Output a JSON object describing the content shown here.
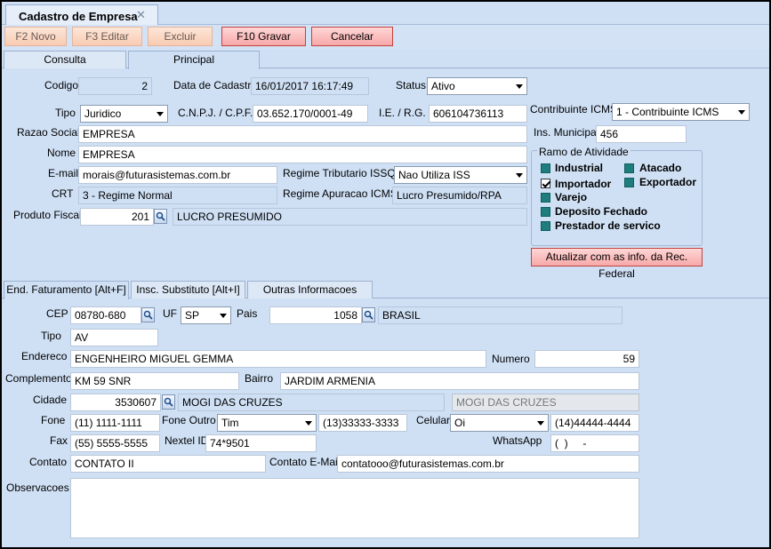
{
  "window": {
    "doc_tab_title": "Cadastro de Empresa",
    "close_glyph": "✕"
  },
  "toolbar": {
    "new": "F2 Novo",
    "edit": "F3 Editar",
    "delete": "Excluir",
    "save": "F10 Gravar",
    "cancel": "Cancelar"
  },
  "main_tabs": [
    {
      "label": "Consulta"
    },
    {
      "label": "Principal"
    }
  ],
  "form": {
    "codigo_label": "Codigo",
    "codigo": "2",
    "data_cadastro_label": "Data de Cadastro",
    "data_cadastro": "16/01/2017 16:17:49",
    "status_label": "Status",
    "status": "Ativo",
    "tipo_label": "Tipo",
    "tipo": "Juridico",
    "cnpj_label": "C.N.P.J. / C.P.F.",
    "cnpj": "03.652.170/0001-49",
    "ie_label": "I.E. / R.G.",
    "ie": "606104736113",
    "contribuinte_label": "Contribuinte ICMS",
    "contribuinte": "1 - Contribuinte ICMS",
    "razao_label": "Razao Social",
    "razao": "EMPRESA",
    "ins_municipal_label": "Ins. Municipal",
    "ins_municipal": "456",
    "nome_label": "Nome",
    "nome": "EMPRESA",
    "email_label": "E-mail",
    "email": "morais@futurasistemas.com.br",
    "regime_issqn_label": "Regime Tributario ISSQN",
    "regime_issqn": "Nao Utiliza ISS",
    "crt_label": "CRT",
    "crt": "3 - Regime Normal",
    "regime_icms_label": "Regime Apuracao ICMS:",
    "regime_icms": "Lucro Presumido/RPA",
    "produto_fiscal_label": "Produto Fiscal",
    "produto_fiscal_code": "201",
    "produto_fiscal_desc": "LUCRO PRESUMIDO"
  },
  "ramo": {
    "title": "Ramo de Atividade",
    "items": [
      {
        "label": "Industrial",
        "checked": false
      },
      {
        "label": "Atacado",
        "checked": false
      },
      {
        "label": "Importador",
        "checked": true
      },
      {
        "label": "Exportador",
        "checked": false
      },
      {
        "label": "Varejo",
        "checked": false
      },
      {
        "label": "Deposito Fechado",
        "checked": false
      },
      {
        "label": "Prestador de servico",
        "checked": false
      }
    ],
    "update_button": "Atualizar com as info. da Rec. Federal"
  },
  "sub_tabs": [
    {
      "label": "End. Faturamento [Alt+F]"
    },
    {
      "label": "Insc. Substituto [Alt+I]"
    },
    {
      "label": "Outras Informacoes [Alt+O]"
    }
  ],
  "address": {
    "cep_label": "CEP",
    "cep": "08780-680",
    "uf_label": "UF",
    "uf": "SP",
    "pais_label": "Pais",
    "pais_code": "1058",
    "pais_name": "BRASIL",
    "tipo_label": "Tipo",
    "tipo": "AV",
    "endereco_label": "Endereco",
    "endereco": "ENGENHEIRO MIGUEL GEMMA",
    "numero_label": "Numero",
    "numero": "59",
    "complemento_label": "Complemento",
    "complemento": "KM 59 SNR",
    "bairro_label": "Bairro",
    "bairro": "JARDIM ARMENIA",
    "cidade_label": "Cidade",
    "cidade_code": "3530607",
    "cidade_name": "MOGI DAS CRUZES",
    "cidade_name2": "MOGI DAS CRUZES",
    "fone_label": "Fone",
    "fone": "(11) 1111-1111",
    "fone_outro_label": "Fone Outro",
    "fone_outro_op": "Tim",
    "fone_outro": "(13)33333-3333",
    "celular_label": "Celular",
    "celular_op": "Oi",
    "celular": "(14)44444-4444",
    "fax_label": "Fax",
    "fax": "(55) 5555-5555",
    "nextel_label": "Nextel ID",
    "nextel": "74*9501",
    "whatsapp_label": "WhatsApp",
    "whatsapp": "(  )     -",
    "contato_label": "Contato",
    "contato": "CONTATO II",
    "contato_email_label": "Contato E-Mail:",
    "contato_email": "contatooo@futurasistemas.com.br",
    "observacoes_label": "Observacoes",
    "observacoes": ""
  }
}
